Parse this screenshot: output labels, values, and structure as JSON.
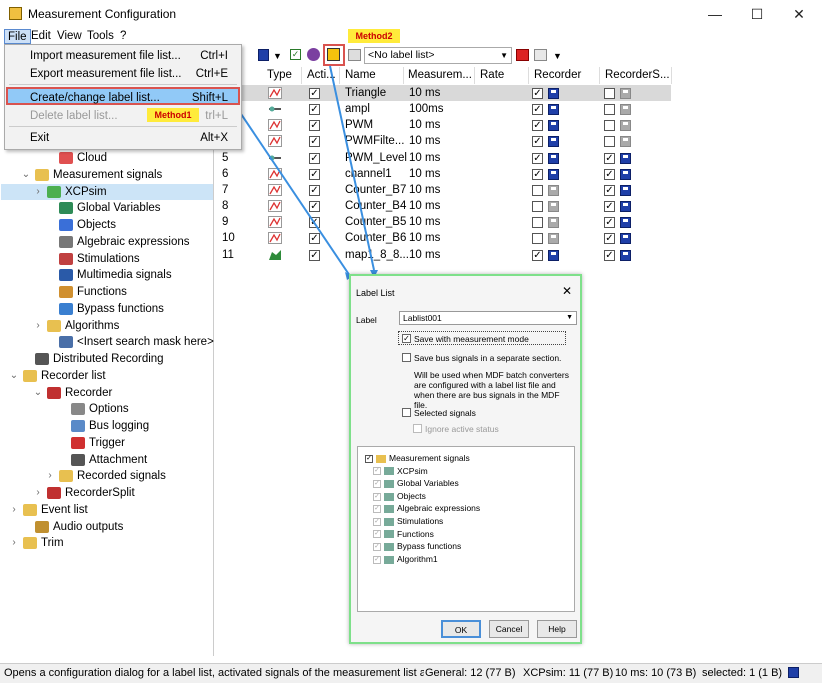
{
  "window": {
    "title": "Measurement Configuration",
    "minimize": "—",
    "maximize": "☐",
    "close": "✕"
  },
  "menubar": [
    "File",
    "Edit",
    "View",
    "Tools",
    "?"
  ],
  "toolbar": {
    "label_list_select": "<No label list>",
    "method2_badge": "Method2"
  },
  "file_menu": {
    "items": [
      {
        "label": "Import measurement file list...",
        "shortcut": "Ctrl+I",
        "enabled": true
      },
      {
        "label": "Export measurement file list...",
        "shortcut": "Ctrl+E",
        "enabled": true
      },
      {
        "label": "Create/change label list...",
        "shortcut": "Shift+L",
        "enabled": true,
        "active": true
      },
      {
        "label": "Delete label list...",
        "shortcut": "trl+L",
        "enabled": false
      },
      {
        "label": "Exit",
        "shortcut": "Alt+X",
        "enabled": true
      }
    ],
    "method1_badge": "Method1"
  },
  "tree": [
    {
      "label": "Cloud",
      "icon": "cloud-icon",
      "indent": 3,
      "arrow": ""
    },
    {
      "label": "Measurement signals",
      "icon": "folder-icon",
      "indent": 1,
      "arrow": "v"
    },
    {
      "label": "XCPsim",
      "icon": "xcp-icon",
      "indent": 2,
      "arrow": ">",
      "selected": true
    },
    {
      "label": "Global Variables",
      "icon": "global-icon",
      "indent": 3,
      "arrow": ""
    },
    {
      "label": "Objects",
      "icon": "objects-icon",
      "indent": 3,
      "arrow": ""
    },
    {
      "label": "Algebraic expressions",
      "icon": "algebra-icon",
      "indent": 3,
      "arrow": ""
    },
    {
      "label": "Stimulations",
      "icon": "stim-icon",
      "indent": 3,
      "arrow": ""
    },
    {
      "label": "Multimedia signals",
      "icon": "multimedia-icon",
      "indent": 3,
      "arrow": ""
    },
    {
      "label": "Functions",
      "icon": "functions-icon",
      "indent": 3,
      "arrow": ""
    },
    {
      "label": "Bypass functions",
      "icon": "bypass-icon",
      "indent": 3,
      "arrow": ""
    },
    {
      "label": "Algorithms",
      "icon": "folder-icon",
      "indent": 2,
      "arrow": ">"
    },
    {
      "label": "<Insert search mask here>",
      "icon": "search-mask-icon",
      "indent": 3,
      "arrow": ""
    },
    {
      "label": "Distributed Recording",
      "icon": "distributed-icon",
      "indent": 1,
      "arrow": ""
    },
    {
      "label": "Recorder list",
      "icon": "folder-icon",
      "indent": 0,
      "arrow": "v"
    },
    {
      "label": "Recorder",
      "icon": "recorder-icon",
      "indent": 2,
      "arrow": "v"
    },
    {
      "label": "Options",
      "icon": "options-icon",
      "indent": 4,
      "arrow": ""
    },
    {
      "label": "Bus logging",
      "icon": "bus-icon",
      "indent": 4,
      "arrow": ""
    },
    {
      "label": "Trigger",
      "icon": "trigger-icon",
      "indent": 4,
      "arrow": ""
    },
    {
      "label": "Attachment",
      "icon": "attachment-icon",
      "indent": 4,
      "arrow": ""
    },
    {
      "label": "Recorded signals",
      "icon": "folder-icon",
      "indent": 3,
      "arrow": ">"
    },
    {
      "label": "RecorderSplit",
      "icon": "recorder-icon",
      "indent": 2,
      "arrow": ">"
    },
    {
      "label": "Event list",
      "icon": "folder-icon",
      "indent": 0,
      "arrow": ">"
    },
    {
      "label": "Audio outputs",
      "icon": "audio-icon",
      "indent": 1,
      "arrow": ""
    },
    {
      "label": "Trim",
      "icon": "folder-icon",
      "indent": 0,
      "arrow": ">"
    }
  ],
  "list": {
    "headers": [
      "Type",
      "Acti...",
      "Name",
      "Measurem...",
      "Rate",
      "Recorder",
      "RecorderS..."
    ],
    "rows": [
      {
        "no": "",
        "name": "Triangle",
        "rate": "10 ms",
        "active": true,
        "rec": true,
        "rec_disk": "blue",
        "split": false,
        "split_disk": "gray",
        "type": "sig"
      },
      {
        "no": "",
        "name": "ampl",
        "rate": "100ms",
        "active": true,
        "rec": true,
        "rec_disk": "blue",
        "split": false,
        "split_disk": "gray",
        "type": "param"
      },
      {
        "no": "",
        "name": "PWM",
        "rate": "10 ms",
        "active": true,
        "rec": true,
        "rec_disk": "blue",
        "split": false,
        "split_disk": "gray",
        "type": "sig"
      },
      {
        "no": "",
        "name": "PWMFilte...",
        "rate": "10 ms",
        "active": true,
        "rec": true,
        "rec_disk": "blue",
        "split": false,
        "split_disk": "gray",
        "type": "sig"
      },
      {
        "no": "5",
        "name": "PWM_Level",
        "rate": "10 ms",
        "active": true,
        "rec": true,
        "rec_disk": "blue",
        "split": true,
        "split_disk": "blue",
        "type": "param"
      },
      {
        "no": "6",
        "name": "channel1",
        "rate": "10 ms",
        "active": true,
        "rec": true,
        "rec_disk": "blue",
        "split": true,
        "split_disk": "blue",
        "type": "sig"
      },
      {
        "no": "7",
        "name": "Counter_B7",
        "rate": "10 ms",
        "active": true,
        "rec": false,
        "rec_disk": "gray",
        "split": true,
        "split_disk": "blue",
        "type": "sig"
      },
      {
        "no": "8",
        "name": "Counter_B4",
        "rate": "10 ms",
        "active": true,
        "rec": false,
        "rec_disk": "gray",
        "split": true,
        "split_disk": "blue",
        "type": "sig"
      },
      {
        "no": "9",
        "name": "Counter_B5",
        "rate": "10 ms",
        "active": true,
        "rec": false,
        "rec_disk": "gray",
        "split": true,
        "split_disk": "blue",
        "type": "sig"
      },
      {
        "no": "10",
        "name": "Counter_B6",
        "rate": "10 ms",
        "active": true,
        "rec": false,
        "rec_disk": "gray",
        "split": true,
        "split_disk": "blue",
        "type": "sig"
      },
      {
        "no": "11",
        "name": "map1_8_8...",
        "rate": "10 ms",
        "active": true,
        "rec": true,
        "rec_disk": "blue",
        "split": true,
        "split_disk": "blue",
        "type": "map"
      }
    ]
  },
  "dialog": {
    "title": "Label List",
    "label_caption": "Label",
    "label_value": "Lablist001",
    "save_with_mm": "Save with measurement mode",
    "save_bus": "Save bus signals in a separate section.",
    "note": "Will be used when MDF batch converters are configured with a label list file and when there are bus signals in the MDF file.",
    "selected_signals": "Selected signals",
    "ignore_active": "Ignore active status",
    "tree": [
      "Measurement signals",
      "XCPsim",
      "Global Variables",
      "Objects",
      "Algebraic expressions",
      "Stimulations",
      "Functions",
      "Bypass functions",
      "Algorithm1"
    ],
    "ok": "OK",
    "cancel": "Cancel",
    "help": "Help"
  },
  "status": {
    "text": "Opens a configuration dialog for a label list, activated signals of the measurement list ar",
    "general": "General:  12 (77 B)",
    "xcpsim": "XCPsim: 11 (77 B)",
    "rate": "10 ms: 10 (73 B)",
    "selected": "selected: 1 (1 B)"
  },
  "colors": {
    "accent": "#d9534f",
    "selection": "#cce4f7",
    "menu_active": "#91c9f7",
    "badge": "#ffeb3b",
    "dialog_border": "#7ee08a"
  }
}
